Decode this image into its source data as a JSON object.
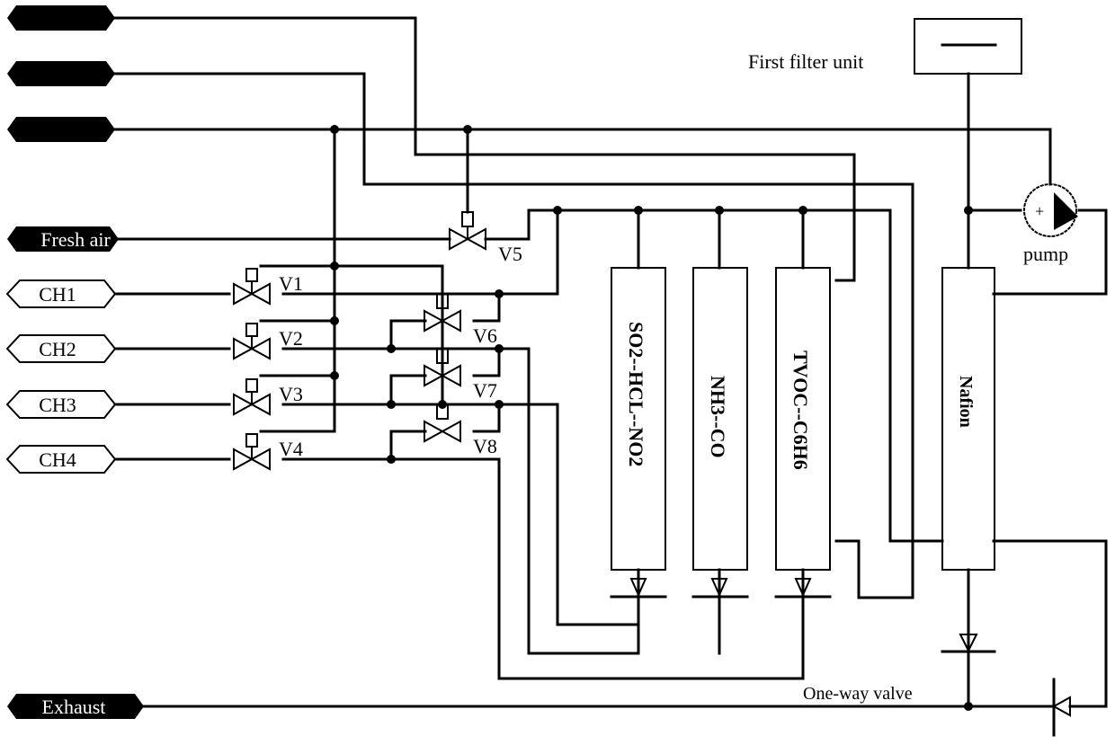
{
  "diagram": {
    "colors": {
      "line": "#000000",
      "background": "#ffffff",
      "tag_fill": "#000000",
      "tag_text": "#ffffff"
    },
    "ports": {
      "top1": "",
      "top2": "",
      "top3": "",
      "fresh_air": "Fresh air",
      "ch1": "CH1",
      "ch2": "CH2",
      "ch3": "CH3",
      "ch4": "CH4",
      "exhaust": "Exhaust"
    },
    "valves": [
      "V1",
      "V2",
      "V3",
      "V4",
      "V5",
      "V6",
      "V7",
      "V8"
    ],
    "sensors": [
      "SO2--HCL--NO2",
      "NH3--CO",
      "TVOC--C6H6"
    ],
    "nafion": "Nafion",
    "pump": "pump",
    "pump_sign": "+",
    "filter_label": "First filter unit",
    "one_way_valve": "One-way valve"
  }
}
